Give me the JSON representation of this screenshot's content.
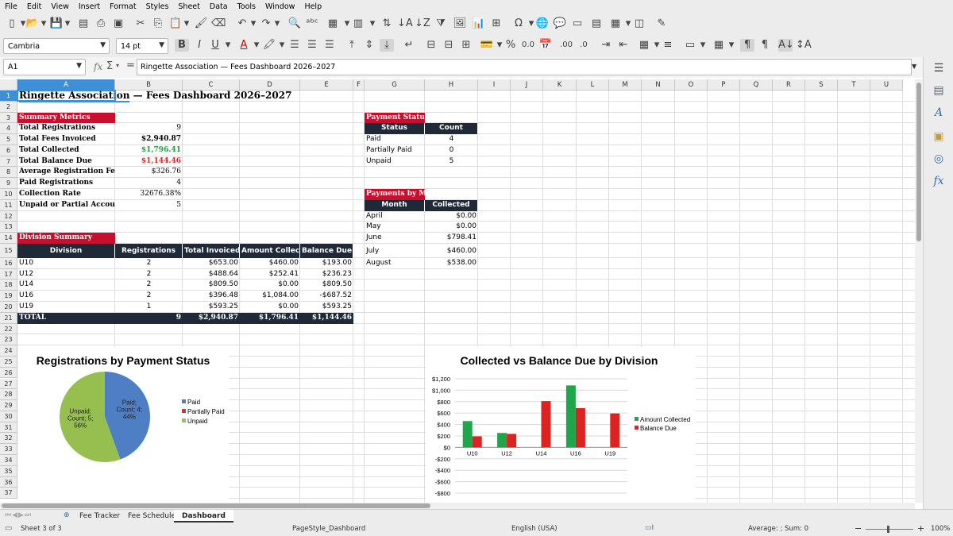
{
  "menu": [
    "File",
    "Edit",
    "View",
    "Insert",
    "Format",
    "Styles",
    "Sheet",
    "Data",
    "Tools",
    "Window",
    "Help"
  ],
  "toolbar2": {
    "font_name": "Cambria",
    "font_size": "14 pt"
  },
  "formula_bar": {
    "cell_ref": "A1",
    "content": "Ringette Association — Fees Dashboard 2026–2027"
  },
  "columns": [
    "A",
    "B",
    "C",
    "D",
    "E",
    "F",
    "G",
    "H",
    "I",
    "J",
    "K",
    "L",
    "M",
    "N",
    "O",
    "P",
    "Q",
    "R",
    "S",
    "T",
    "U"
  ],
  "rows": [
    "1",
    "2",
    "3",
    "4",
    "5",
    "6",
    "7",
    "8",
    "9",
    "10",
    "11",
    "12",
    "13",
    "14",
    "15",
    "16",
    "17",
    "18",
    "19",
    "20",
    "21",
    "22",
    "23",
    "24",
    "25",
    "26",
    "27",
    "28",
    "29",
    "30",
    "31",
    "32",
    "33",
    "34",
    "35",
    "36",
    "37"
  ],
  "title_a": "Ringette Association",
  "title_b": " — Fees Dashboard 2026–2027",
  "summary": {
    "header": "Summary Metrics",
    "items": [
      {
        "label": "Total Registrations",
        "value": "9",
        "style": "plain"
      },
      {
        "label": "Total Fees Invoiced",
        "value": "$2,940.87",
        "style": "bold"
      },
      {
        "label": "Total Collected",
        "value": "$1,796.41",
        "style": "green"
      },
      {
        "label": "Total Balance Due",
        "value": "$1,144.46",
        "style": "red"
      },
      {
        "label": "Average Registration Fee",
        "value": "$326.76",
        "style": "plain"
      },
      {
        "label": "Paid Registrations",
        "value": "4",
        "style": "plain"
      },
      {
        "label": "Collection Rate",
        "value": "32676.38%",
        "style": "plain"
      },
      {
        "label": "Unpaid or Partial Accounts",
        "value": "5",
        "style": "plain"
      }
    ]
  },
  "division": {
    "header": "Division Summary",
    "cols": [
      "Division",
      "Registrations",
      "Total Invoiced",
      "Amount Collected",
      "Balance Due"
    ],
    "rows": [
      [
        "U10",
        "2",
        "$653.00",
        "$460.00",
        "$193.00"
      ],
      [
        "U12",
        "2",
        "$488.64",
        "$252.41",
        "$236.23"
      ],
      [
        "U14",
        "2",
        "$809.50",
        "$0.00",
        "$809.50"
      ],
      [
        "U16",
        "2",
        "$396.48",
        "$1,084.00",
        "-$687.52"
      ],
      [
        "U19",
        "1",
        "$593.25",
        "$0.00",
        "$593.25"
      ]
    ],
    "total": [
      "TOTAL",
      "9",
      "$2,940.87",
      "$1,796.41",
      "$1,144.46"
    ]
  },
  "pay_status": {
    "header": "Payment Status Br",
    "cols": [
      "Status",
      "Count"
    ],
    "rows": [
      [
        "Paid",
        "4"
      ],
      [
        "Partially Paid",
        "0"
      ],
      [
        "Unpaid",
        "5"
      ]
    ]
  },
  "pay_month": {
    "header": "Payments by Mont",
    "cols": [
      "Month",
      "Collected"
    ],
    "rows": [
      [
        "April",
        "$0.00"
      ],
      [
        "May",
        "$0.00"
      ],
      [
        "June",
        "$798.41"
      ],
      [
        "July",
        "$460.00"
      ],
      [
        "August",
        "$538.00"
      ]
    ]
  },
  "chart_data": [
    {
      "type": "pie",
      "title": "Registrations by Payment Status",
      "categories": [
        "Paid",
        "Partially Paid",
        "Unpaid"
      ],
      "values": [
        4,
        0,
        5
      ],
      "data_labels": [
        "Paid; Count; 4; 44%",
        "",
        "Unpaid; Count; 5; 56%"
      ],
      "colors": [
        "#4e7ec4",
        "#d93030",
        "#96bf4f"
      ],
      "legend": "right"
    },
    {
      "type": "bar",
      "title": "Collected vs Balance Due by Division",
      "categories": [
        "U10",
        "U12",
        "U14",
        "U16",
        "U19"
      ],
      "series": [
        {
          "name": "Amount Collected",
          "values": [
            460,
            252.41,
            0,
            1084,
            0
          ],
          "color": "#1fa64a"
        },
        {
          "name": "Balance Due",
          "values": [
            193,
            236.23,
            809.5,
            687.52,
            593.25
          ],
          "color": "#dd2222"
        }
      ],
      "ylim": [
        -800,
        1200
      ],
      "yticks": [
        "$1,200",
        "$1,000",
        "$800",
        "$600",
        "$400",
        "$200",
        "$0",
        "-$200",
        "-$400",
        "-$600",
        "-$800"
      ],
      "legend": "right",
      "grid": true
    }
  ],
  "tabs": [
    "Fee Tracker",
    "Fee Schedule",
    "Dashboard"
  ],
  "status": {
    "sheet": "Sheet 3 of 3",
    "pagestyle": "PageStyle_Dashboard",
    "language": "English (USA)",
    "sum": "Average: ; Sum: 0",
    "zoom": "100%"
  }
}
